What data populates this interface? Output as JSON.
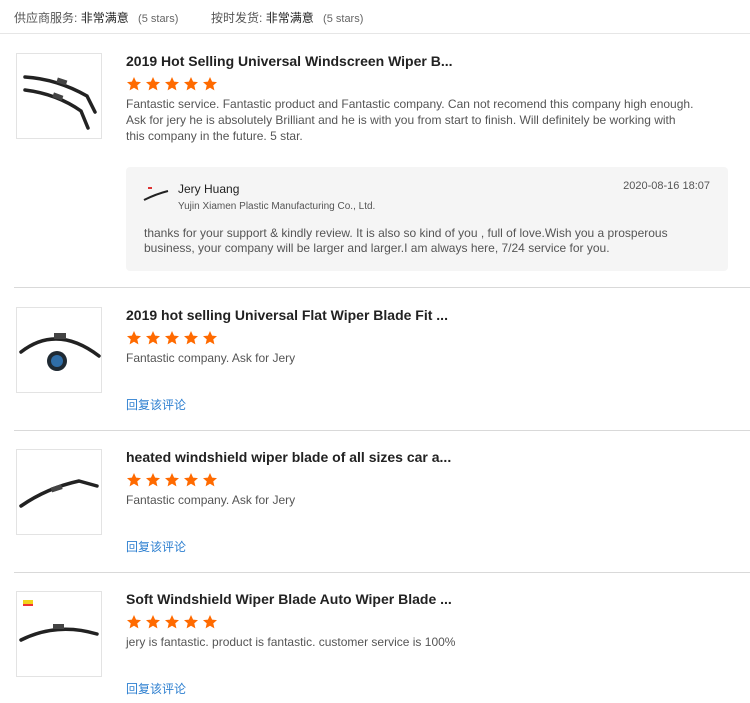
{
  "ratings": {
    "supplier_service": {
      "label": "供应商服务:",
      "value": "非常满意",
      "stars": "(5 stars)"
    },
    "on_time_shipment": {
      "label": "按时发货:",
      "value": "非常满意",
      "stars": "(5 stars)"
    }
  },
  "colors": {
    "star": "#ff6a00",
    "link": "#2d7fd0",
    "reply_bg": "#f5f5f5"
  },
  "reviews": [
    {
      "product_title": "2019 Hot Selling Universal Windscreen Wiper B...",
      "rating": 5,
      "comment": "Fantastic service. Fantastic product and Fantastic company. Can not recomend this company high enough. Ask for jery he is absolutely Brilliant and he is with you from start to finish. Will definitely be working with this company in the future. 5 star.",
      "thumbnail_icon": "wiper-blade-pair-icon",
      "supplier_reply": {
        "name": "Jery Huang",
        "company": "Yujin Xiamen Plastic Manufacturing Co., Ltd.",
        "date": "2020-08-16 18:07",
        "text": "thanks for your support & kindly review. It is also so kind of you , full of love.Wish you a prosperous business, your company will be larger and larger.I am always here, 7/24 service for you."
      }
    },
    {
      "product_title": "2019 hot selling Universal Flat Wiper Blade Fit ...",
      "rating": 5,
      "comment": "Fantastic company. Ask for Jery",
      "thumbnail_icon": "flat-wiper-blade-icon",
      "reply_link": "回复该评论"
    },
    {
      "product_title": "heated windshield wiper blade of all sizes car a...",
      "rating": 5,
      "comment": "Fantastic company. Ask for Jery",
      "thumbnail_icon": "heated-wiper-blade-icon",
      "reply_link": "回复该评论"
    },
    {
      "product_title": "Soft Windshield Wiper Blade Auto Wiper Blade ...",
      "rating": 5,
      "comment": "jery is fantastic. product is fantastic. customer service is 100%",
      "thumbnail_icon": "soft-wiper-blade-icon",
      "reply_link": "回复该评论"
    }
  ]
}
